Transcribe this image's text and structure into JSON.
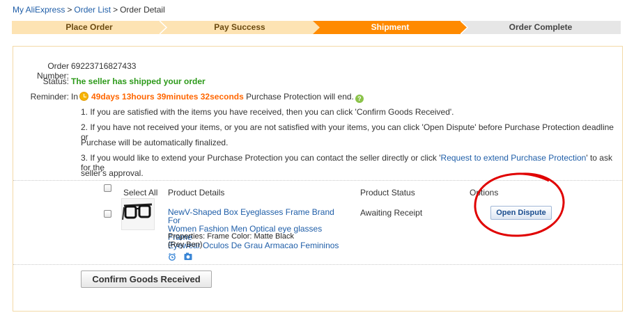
{
  "breadcrumb": {
    "items": [
      "My AliExpress",
      "Order List",
      "Order Detail"
    ],
    "separator": ">"
  },
  "steps": [
    {
      "label": "Place Order",
      "state": "done"
    },
    {
      "label": "Pay Success",
      "state": "done"
    },
    {
      "label": "Shipment",
      "state": "current"
    },
    {
      "label": "Order Complete",
      "state": "todo"
    }
  ],
  "colors": {
    "step_done": "#fde3b3",
    "step_current": "#ff8a00",
    "step_todo": "#e6e6e6",
    "status_green": "#2d9a1a",
    "countdown": "#ff6600",
    "annotation": "#e00000"
  },
  "order": {
    "number_label": "Order Number:",
    "number": "69223716827433",
    "status_label": "Status:",
    "status": "The seller has shipped your order",
    "reminder_label": "Reminder:",
    "reminder_prefix": "In",
    "countdown": "49days 13hours 39minutes 32seconds",
    "reminder_suffix": "Purchase Protection will end.",
    "note1": "1. If you are satisfied with the items you have received, then you can click 'Confirm Goods Received'.",
    "note2_line1": "2. If you have not received your items, or you are not satisfied with your items, you can click 'Open Dispute' before Purchase Protection deadline or",
    "note2_line2": "Purchase will be automatically finalized.",
    "note3_prefix": "3. If you would like to extend your Purchase Protection you can contact the seller directly or click '",
    "note3_link": "Request to extend Purchase Protection",
    "note3_suffix": "' to ask for the",
    "note3_line2": "seller's approval."
  },
  "table": {
    "select_all": "Select All",
    "col_details": "Product Details",
    "col_status": "Product Status",
    "col_options": "Options"
  },
  "product": {
    "name_line1": "NewV-Shaped Box Eyeglasses Frame Brand For",
    "name_line2": "Women Fashion Men Optical eye glasses Frame",
    "name_line3": "Eyewear Oculos De Grau Armacao Femininos",
    "properties": "Properties: Frame Color: Matte Black",
    "properties2": "(Rey Ben)",
    "status": "Awaiting Receipt",
    "icons": [
      "alarm-clock-icon",
      "snapshot-icon"
    ]
  },
  "buttons": {
    "open_dispute": "Open Dispute",
    "confirm": "Confirm Goods Received"
  }
}
